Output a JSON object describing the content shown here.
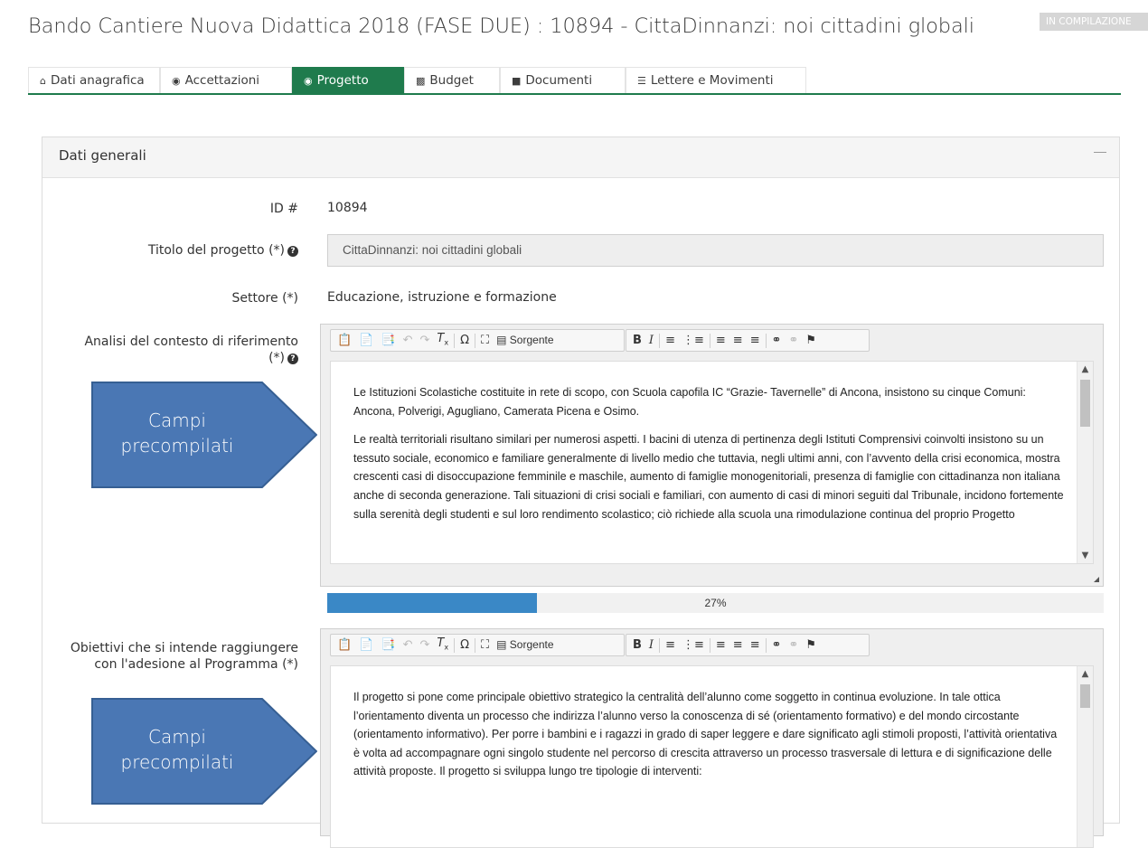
{
  "header": {
    "title": "Bando Cantiere Nuova Didattica 2018 (FASE DUE) : 10894 - CittaDinnanzi: noi cittadini globali",
    "status_badge": "IN COMPILAZIONE"
  },
  "tabs": [
    {
      "label": "Dati anagrafica",
      "icon": "home-icon",
      "active": false
    },
    {
      "label": "Accettazioni",
      "icon": "eye-icon",
      "active": false
    },
    {
      "label": "Progetto",
      "icon": "globe-icon",
      "active": true
    },
    {
      "label": "Budget",
      "icon": "money-icon",
      "active": false
    },
    {
      "label": "Documenti",
      "icon": "file-icon",
      "active": false
    },
    {
      "label": "Lettere e Movimenti",
      "icon": "list-icon",
      "active": false
    }
  ],
  "panel": {
    "title": "Dati generali",
    "collapse_icon": "minus-icon"
  },
  "fields": {
    "id_label": "ID #",
    "id_value": "10894",
    "titolo_label": "Titolo del progetto (*)",
    "titolo_value": "CittaDinnanzi: noi cittadini globali",
    "settore_label": "Settore (*)",
    "settore_value": "Educazione, istruzione e formazione",
    "analisi_label_1": "Analisi del contesto di riferimento",
    "analisi_label_2": "(*)",
    "obiettivi_label_1": "Obiettivi che si intende raggiungere",
    "obiettivi_label_2": "con l'adesione al Programma (*)"
  },
  "toolbar": {
    "source_label": "Sorgente",
    "bold_label": "B",
    "italic_label": "I",
    "omega_label": "Ω"
  },
  "editor_analisi": {
    "paragraphs": [
      "Le Istituzioni Scolastiche costituite in rete di scopo, con Scuola capofila IC “Grazie- Tavernelle” di Ancona, insistono su cinque Comuni: Ancona, Polverigi, Agugliano, Camerata Picena e Osimo.",
      "Le realtà territoriali risultano similari per numerosi aspetti. I bacini di utenza di pertinenza degli Istituti Comprensivi coinvolti insistono su un tessuto sociale,  economico e familiare generalmente di livello medio che tuttavia, negli ultimi anni, con l’avvento della crisi economica, mostra crescenti casi di disoccupazione femminile e maschile, aumento di famiglie monogenitoriali, presenza di famiglie con cittadinanza non italiana anche di seconda generazione. Tali situazioni di crisi sociali e familiari, con aumento di casi di minori seguiti dal Tribunale, incidono fortemente sulla serenità degli studenti e sul loro rendimento scolastico; ciò richiede alla scuola una rimodulazione continua del proprio Progetto"
    ]
  },
  "progress": {
    "value": 0.27,
    "label": "27%"
  },
  "editor_obiettivi": {
    "paragraphs": [
      "Il progetto si pone come principale obiettivo strategico la centralità dell’alunno come soggetto in continua evoluzione. In tale ottica l’orientamento diventa un processo che indirizza l’alunno verso la conoscenza di sé (orientamento formativo) e del mondo circostante (orientamento informativo). Per porre i bambini e i ragazzi  in grado di saper leggere e dare significato agli stimoli proposti, l’attività orientativa è volta ad accompagnare ogni singolo studente nel percorso di crescita attraverso un processo trasversale di lettura e di significazione delle attività proposte. Il progetto si sviluppa lungo tre tipologie di interventi:"
    ]
  },
  "callouts": [
    {
      "line1": "Campi",
      "line2": "precompilati"
    },
    {
      "line1": "Campi",
      "line2": "precompilati"
    }
  ],
  "colors": {
    "accent_green": "#1f7b4d",
    "progress_blue": "#3a88c6",
    "callout_fill": "#4a77b4"
  }
}
